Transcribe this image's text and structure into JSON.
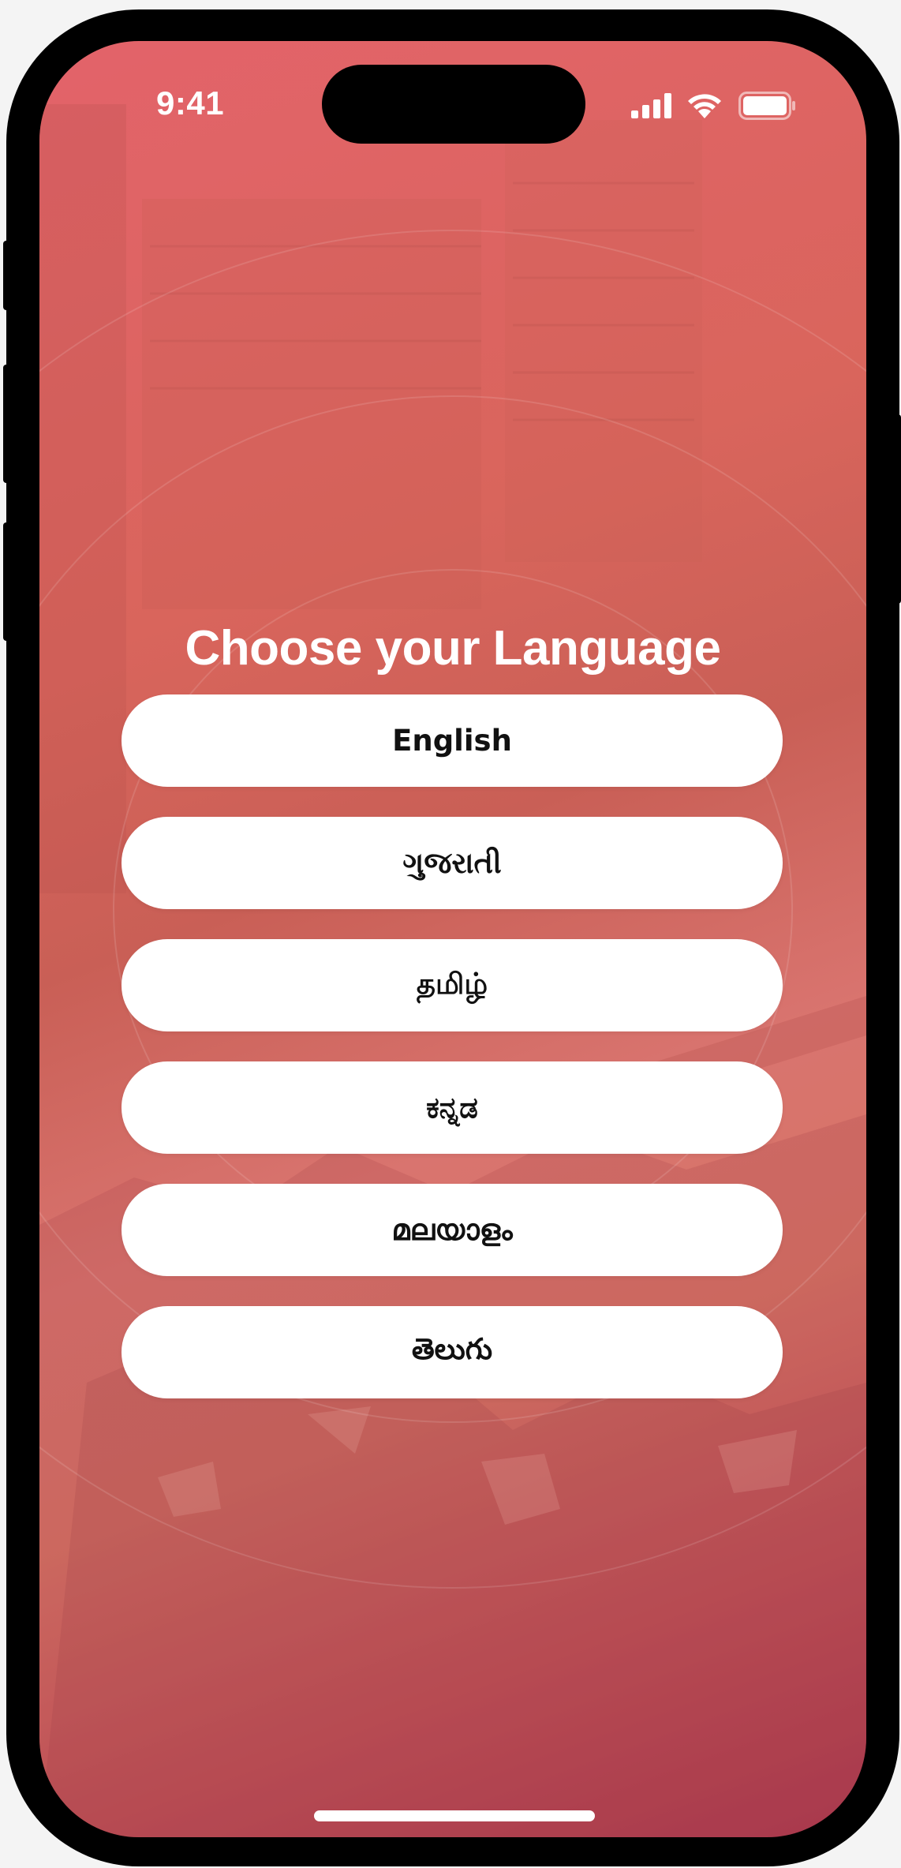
{
  "status_bar": {
    "time": "9:41",
    "icons": [
      "cellular-signal-icon",
      "wifi-icon",
      "battery-icon"
    ]
  },
  "screen": {
    "title": "Choose your Language",
    "languages": [
      {
        "label": "English"
      },
      {
        "label": "ગુજરાતી"
      },
      {
        "label": "தமிழ்"
      },
      {
        "label": "ಕನ್ನಡ"
      },
      {
        "label": "മലയാളം"
      },
      {
        "label": "తెలుగు"
      }
    ]
  },
  "colors": {
    "gradient_top": "#e3636a",
    "gradient_bottom": "#ad3550",
    "button_bg": "#ffffff",
    "button_text": "#111111",
    "title_text": "#ffffff"
  }
}
